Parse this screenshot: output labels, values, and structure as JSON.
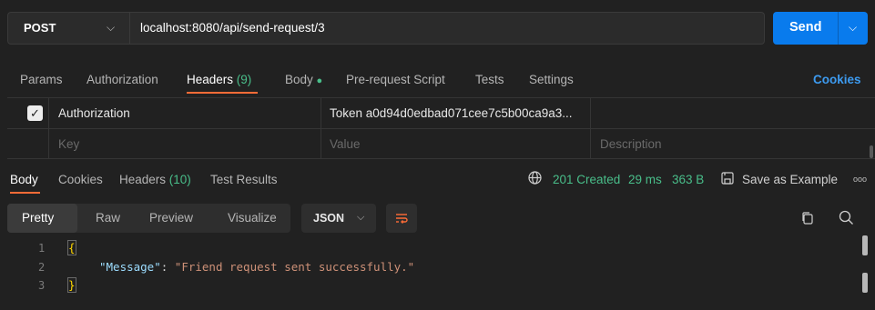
{
  "request": {
    "method": "POST",
    "url": "localhost:8080/api/send-request/3",
    "send_label": "Send"
  },
  "request_tabs": {
    "params": "Params",
    "authorization": "Authorization",
    "headers_label": "Headers",
    "headers_count": "(9)",
    "body": "Body",
    "pre_request": "Pre-request Script",
    "tests": "Tests",
    "settings": "Settings",
    "cookies": "Cookies"
  },
  "headers_table": {
    "row": {
      "key": "Authorization",
      "value": "Token a0d94d0edbad071cee7c5b00ca9a3...",
      "checked": true
    },
    "placeholders": {
      "key": "Key",
      "value": "Value",
      "description": "Description"
    }
  },
  "response_tabs": {
    "body": "Body",
    "cookies": "Cookies",
    "headers_label": "Headers",
    "headers_count": "(10)",
    "test_results": "Test Results"
  },
  "response_status": {
    "status": "201 Created",
    "time": "29 ms",
    "size": "363 B",
    "save_example": "Save as Example",
    "more": "ooo"
  },
  "body_toolbar": {
    "modes": [
      "Pretty",
      "Raw",
      "Preview",
      "Visualize"
    ],
    "selected_mode": "Pretty",
    "format": "JSON"
  },
  "code": {
    "line_numbers": [
      "1",
      "2",
      "3"
    ],
    "open_brace": "{",
    "key": "\"Message\"",
    "colon": ": ",
    "value": "\"Friend request sent successfully.\"",
    "close_brace": "}"
  },
  "colors": {
    "accent_orange": "#ff6c37",
    "send_blue": "#097bed",
    "success_green": "#49be8a",
    "link_blue": "#3d9bf0"
  }
}
